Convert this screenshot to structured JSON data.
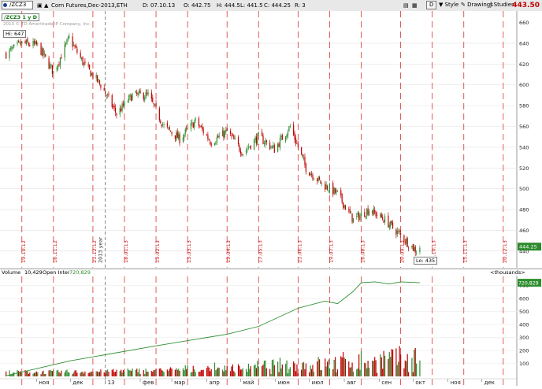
{
  "toolbar": {
    "symbol": "/ZCZ3",
    "description": "Corn Futures,Dec-2013,ETH",
    "d": "D: 07.10.13",
    "o": "O: 442.75",
    "h": "H: 444.5",
    "l": "L: 441.5",
    "c": "C: 444.25",
    "r": "R: 3",
    "d_button": "D",
    "style": "Style",
    "drawings": "Drawings",
    "studies": "Studies",
    "last_price": "443.50"
  },
  "upper": {
    "tag": "/ZCZ3 1 y D",
    "copyright": "2013 © TD Ameritrade IP Company, Inc.",
    "hi_label": "Hi: 647",
    "lo_label": "Lo: 435",
    "price_label": "444.25",
    "y_ticks": [
      640,
      620,
      600,
      580,
      560,
      540,
      520,
      500,
      480,
      460,
      440
    ],
    "y_top_tick": "660",
    "date_markers": [
      "19.10.12",
      "16.11.12",
      "21.12.12",
      "18.01.13",
      "15.02.13",
      "15.03.13",
      "19.04.13",
      "17.05.13",
      "21.06.13",
      "19.07.13",
      "16.08.13",
      "20.09.13",
      "18.10.13",
      "15.11.13",
      "20.12.13"
    ],
    "year_marker": "2013 year"
  },
  "lower": {
    "volume_label": "Volume",
    "volume_value": "10,429",
    "oi_label": "Open Interest",
    "oi_value": "720,829",
    "units": "<thousands>",
    "y_ticks": [
      "700",
      "600",
      "500",
      "400",
      "300",
      "200",
      "100"
    ],
    "oi_price_label": "720,829"
  },
  "x_axis": [
    "ноя",
    "дек",
    "13",
    "фев",
    "мар",
    "апр",
    "май",
    "июн",
    "июл",
    "авг",
    "сен",
    "окт",
    "ноя",
    "дек"
  ],
  "colors": {
    "up": "#2e8b2e",
    "down": "#c00000",
    "grid_red": "#d33",
    "oi": "#2f8f2f"
  },
  "chart_data": {
    "type": "candlestick",
    "symbol": "/ZCZ3",
    "y_range": [
      430,
      665
    ],
    "approx_close_path": [
      {
        "date": "2012-10-05",
        "close": 630
      },
      {
        "date": "2012-10-19",
        "close": 640
      },
      {
        "date": "2012-11-02",
        "close": 638
      },
      {
        "date": "2012-11-16",
        "close": 612
      },
      {
        "date": "2012-11-30",
        "close": 645
      },
      {
        "date": "2012-12-14",
        "close": 618
      },
      {
        "date": "2012-12-28",
        "close": 600
      },
      {
        "date": "2013-01-11",
        "close": 572
      },
      {
        "date": "2013-01-25",
        "close": 590
      },
      {
        "date": "2013-02-08",
        "close": 590
      },
      {
        "date": "2013-02-22",
        "close": 560
      },
      {
        "date": "2013-03-08",
        "close": 548
      },
      {
        "date": "2013-03-22",
        "close": 565
      },
      {
        "date": "2013-04-05",
        "close": 545
      },
      {
        "date": "2013-04-19",
        "close": 555
      },
      {
        "date": "2013-05-03",
        "close": 535
      },
      {
        "date": "2013-05-17",
        "close": 550
      },
      {
        "date": "2013-05-31",
        "close": 538
      },
      {
        "date": "2013-06-14",
        "close": 560
      },
      {
        "date": "2013-06-28",
        "close": 520
      },
      {
        "date": "2013-07-12",
        "close": 505
      },
      {
        "date": "2013-07-26",
        "close": 495
      },
      {
        "date": "2013-08-09",
        "close": 470
      },
      {
        "date": "2013-08-23",
        "close": 480
      },
      {
        "date": "2013-09-06",
        "close": 470
      },
      {
        "date": "2013-09-20",
        "close": 455
      },
      {
        "date": "2013-10-04",
        "close": 440
      },
      {
        "date": "2013-10-07",
        "close": 444.25
      }
    ],
    "hi": 647,
    "lo": 435,
    "last": 444.25
  }
}
